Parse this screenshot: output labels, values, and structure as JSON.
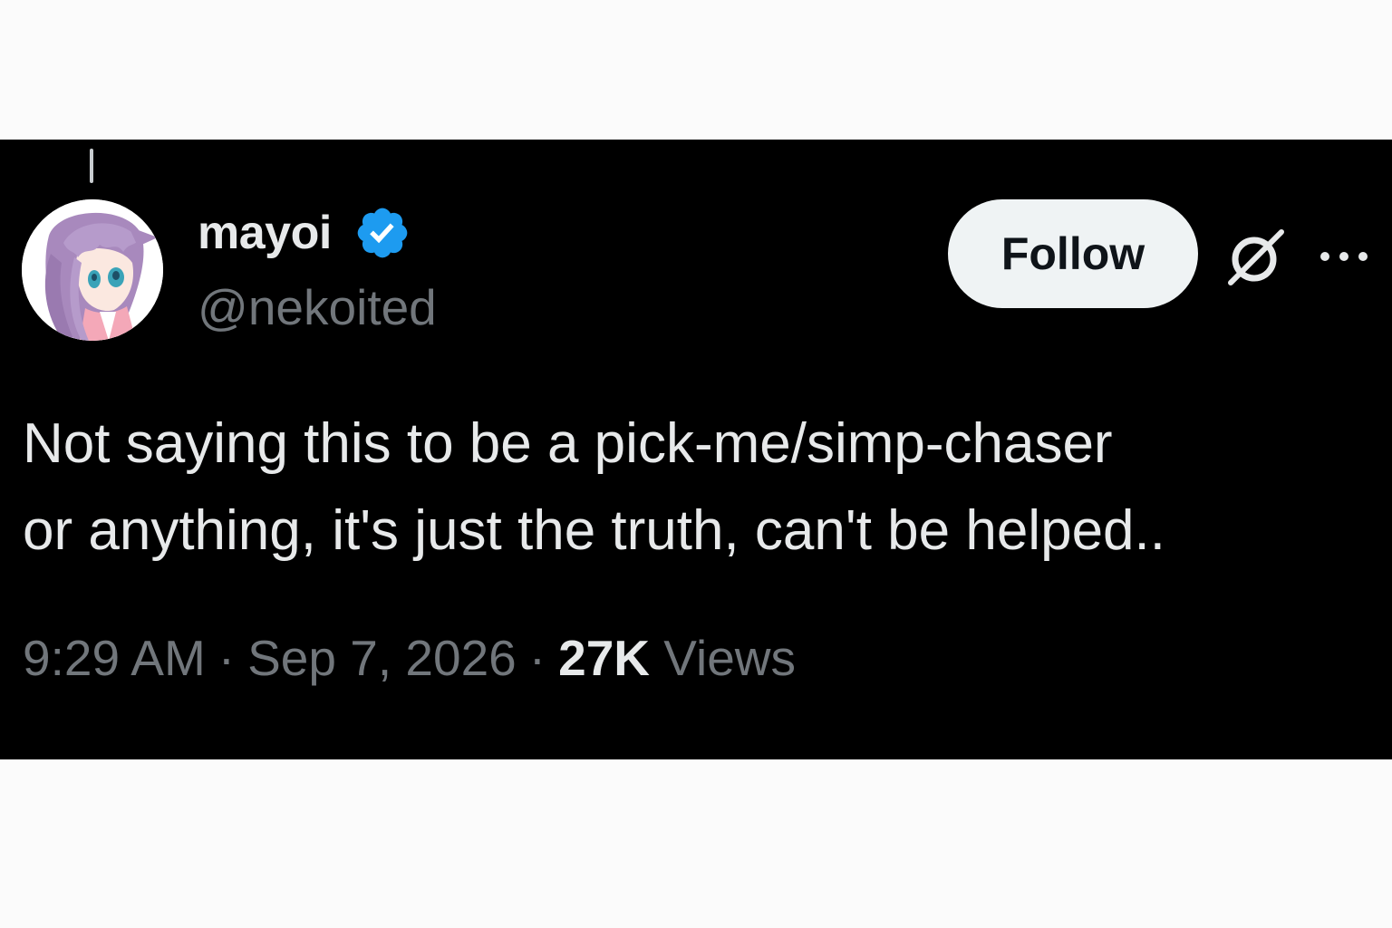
{
  "tweet": {
    "author": {
      "display_name": "mayoi",
      "handle": "@nekoited",
      "verified": true
    },
    "follow_label": "Follow",
    "text_lines": [
      "Not saying this to be a pick-me/simp-chaser",
      "or anything, it's just the truth, can't be helped.."
    ],
    "time": "9:29 AM",
    "date": "Sep 7, 2026",
    "separator": "·",
    "views_count": "27K",
    "views_label": "Views"
  },
  "icons": {
    "verified": "verified-badge-icon",
    "grok": "grok-icon",
    "more": "more-options-icon"
  },
  "colors": {
    "background": "#000000",
    "text_primary": "#e7e9ea",
    "text_secondary": "#71767b",
    "verified_blue": "#1d9bf0",
    "follow_bg": "#eff3f4",
    "follow_text": "#0f1419"
  }
}
